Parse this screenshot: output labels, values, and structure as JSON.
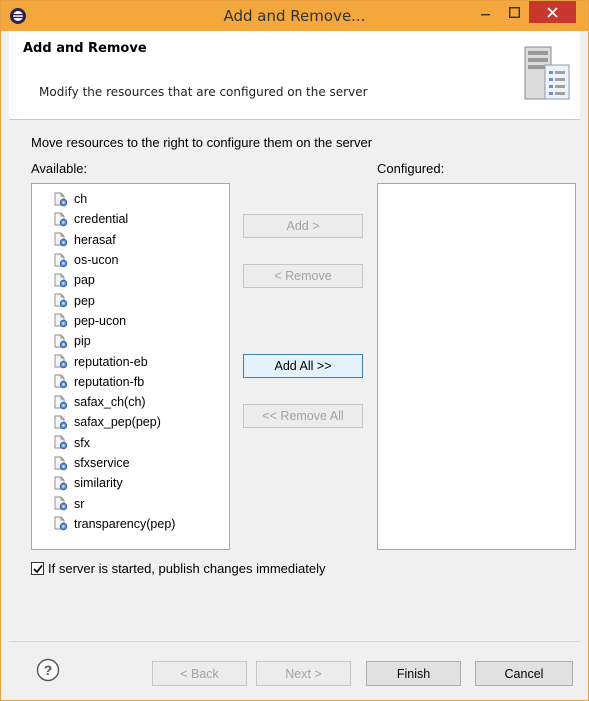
{
  "window": {
    "title": "Add and Remove...",
    "accent_color": "#f4a73d",
    "close_color": "#c7372d"
  },
  "banner": {
    "title": "Add and Remove",
    "description": "Modify the resources that are configured on the server",
    "icon": "server-icon"
  },
  "instruction": "Move resources to the right to configure them on the server",
  "available": {
    "label": "Available:",
    "items": [
      "ch",
      "credential",
      "herasaf",
      "os-ucon",
      "pap",
      "pep",
      "pep-ucon",
      "pip",
      "reputation-eb",
      "reputation-fb",
      "safax_ch(ch)",
      "safax_pep(pep)",
      "sfx",
      "sfxservice",
      "similarity",
      "sr",
      "transparency(pep)"
    ]
  },
  "configured": {
    "label": "Configured:",
    "items": []
  },
  "buttons": {
    "add": "Add >",
    "remove": "< Remove",
    "add_all": "Add All >>",
    "remove_all": "<< Remove All",
    "back": "< Back",
    "next": "Next >",
    "finish": "Finish",
    "cancel": "Cancel"
  },
  "publish": {
    "label": "If server is started, publish changes immediately",
    "checked": true
  }
}
